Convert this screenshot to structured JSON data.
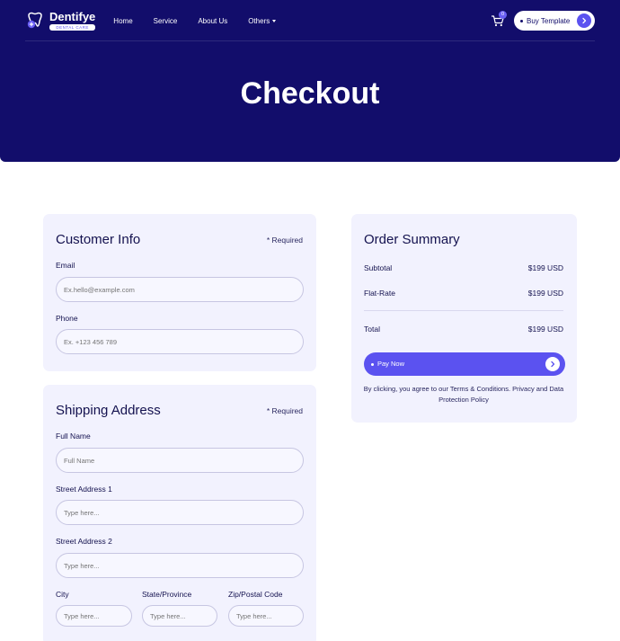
{
  "nav": {
    "brand": "Dentifye",
    "tagline": "DENTAL CARE",
    "items": [
      {
        "label": "Home"
      },
      {
        "label": "Service"
      },
      {
        "label": "About Us"
      },
      {
        "label": "Others"
      }
    ],
    "cart_count": "0",
    "buy_label": "Buy Template"
  },
  "page_title": "Checkout",
  "customer_info": {
    "title": "Customer Info",
    "required": "* Required",
    "email_label": "Email",
    "email_placeholder": "Ex.hello@example.com",
    "phone_label": "Phone",
    "phone_placeholder": "Ex. +123 456 789"
  },
  "shipping": {
    "title": "Shipping Address",
    "required": "* Required",
    "full_name_label": "Full Name",
    "full_name_placeholder": "Full Name",
    "street1_label": "Street Address 1",
    "street1_placeholder": "Type here...",
    "street2_label": "Street Address 2",
    "street2_placeholder": "Type here...",
    "city_label": "City",
    "city_placeholder": "Type here...",
    "state_label": "State/Province",
    "state_placeholder": "Type here...",
    "zip_label": "Zip/Postal Code",
    "zip_placeholder": "Type here..."
  },
  "order_summary": {
    "title": "Order Summary",
    "subtotal_label": "Subtotal",
    "subtotal_value": "$199 USD",
    "flat_rate_label": "Flat-Rate",
    "flat_rate_value": "$199 USD",
    "total_label": "Total",
    "total_value": "$199 USD",
    "pay_label": "Pay Now",
    "terms": "By clicking, you agree to our Terms & Conditions. Privacy and Data Protection Policy"
  },
  "colors": {
    "hero": "#120d6b",
    "accent": "#5b52f0",
    "card": "#f2f2fe"
  }
}
